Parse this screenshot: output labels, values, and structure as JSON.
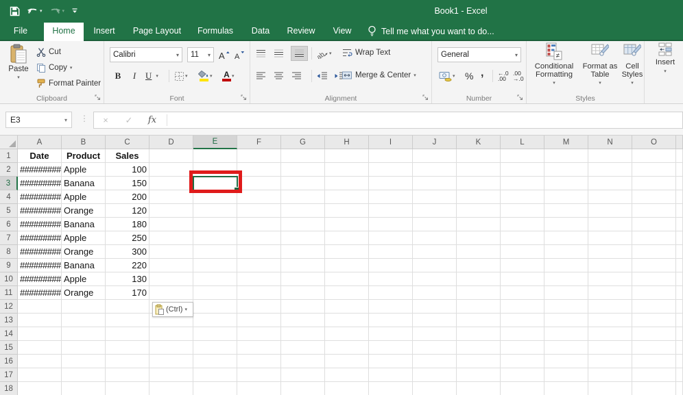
{
  "window": {
    "title": "Book1 - Excel"
  },
  "colors": {
    "brand_green": "#217346",
    "annotation_red": "#e01b1b",
    "selection_green": "#1f6b43",
    "fill_yellow": "#ffe400",
    "font_color_red": "#c00000"
  },
  "tabs": {
    "file": "File",
    "items": [
      "Home",
      "Insert",
      "Page Layout",
      "Formulas",
      "Data",
      "Review",
      "View"
    ],
    "active": "Home",
    "tell_me": "Tell me what you want to do..."
  },
  "ribbon": {
    "clipboard": {
      "label": "Clipboard",
      "paste": "Paste",
      "cut": "Cut",
      "copy": "Copy",
      "format_painter": "Format Painter"
    },
    "font": {
      "label": "Font",
      "family": "Calibri",
      "size": "11",
      "bold": "B",
      "italic": "I",
      "underline": "U"
    },
    "alignment": {
      "label": "Alignment",
      "wrap_text": "Wrap Text",
      "merge_center": "Merge & Center"
    },
    "number": {
      "label": "Number",
      "format": "General",
      "percent": "%",
      "comma": ",",
      "increase_decimal": {
        "top": "←.0",
        "bottom": ".00"
      },
      "decrease_decimal": {
        "top": ".00",
        "bottom": "→.0"
      }
    },
    "styles": {
      "label": "Styles",
      "conditional_formatting": "Conditional Formatting",
      "format_as_table": "Format as Table",
      "cell_styles": "Cell Styles"
    },
    "cells": {
      "insert": "Insert"
    }
  },
  "formula_bar": {
    "name_box": "E3",
    "fx_label": "fx",
    "value": ""
  },
  "grid": {
    "columns": [
      "A",
      "B",
      "C",
      "D",
      "E",
      "F",
      "G",
      "H",
      "I",
      "J",
      "K",
      "L",
      "M",
      "N",
      "O"
    ],
    "row_count": 18,
    "selected": {
      "cell": "E3",
      "column": "E",
      "row": 3
    },
    "data_rows": [
      {
        "row": 1,
        "A": "Date",
        "B": "Product",
        "C": "Sales",
        "is_header": true
      },
      {
        "row": 2,
        "A": "#########",
        "B": "Apple",
        "C": "100"
      },
      {
        "row": 3,
        "A": "#########",
        "B": "Banana",
        "C": "150"
      },
      {
        "row": 4,
        "A": "#########",
        "B": "Apple",
        "C": "200"
      },
      {
        "row": 5,
        "A": "#########",
        "B": "Orange",
        "C": "120"
      },
      {
        "row": 6,
        "A": "#########",
        "B": "Banana",
        "C": "180"
      },
      {
        "row": 7,
        "A": "#########",
        "B": "Apple",
        "C": "250"
      },
      {
        "row": 8,
        "A": "#########",
        "B": "Orange",
        "C": "300"
      },
      {
        "row": 9,
        "A": "#########",
        "B": "Banana",
        "C": "220"
      },
      {
        "row": 10,
        "A": "#########",
        "B": "Apple",
        "C": "130"
      },
      {
        "row": 11,
        "A": "#########",
        "B": "Orange",
        "C": "170"
      }
    ]
  },
  "paste_options": {
    "label": "(Ctrl)"
  }
}
